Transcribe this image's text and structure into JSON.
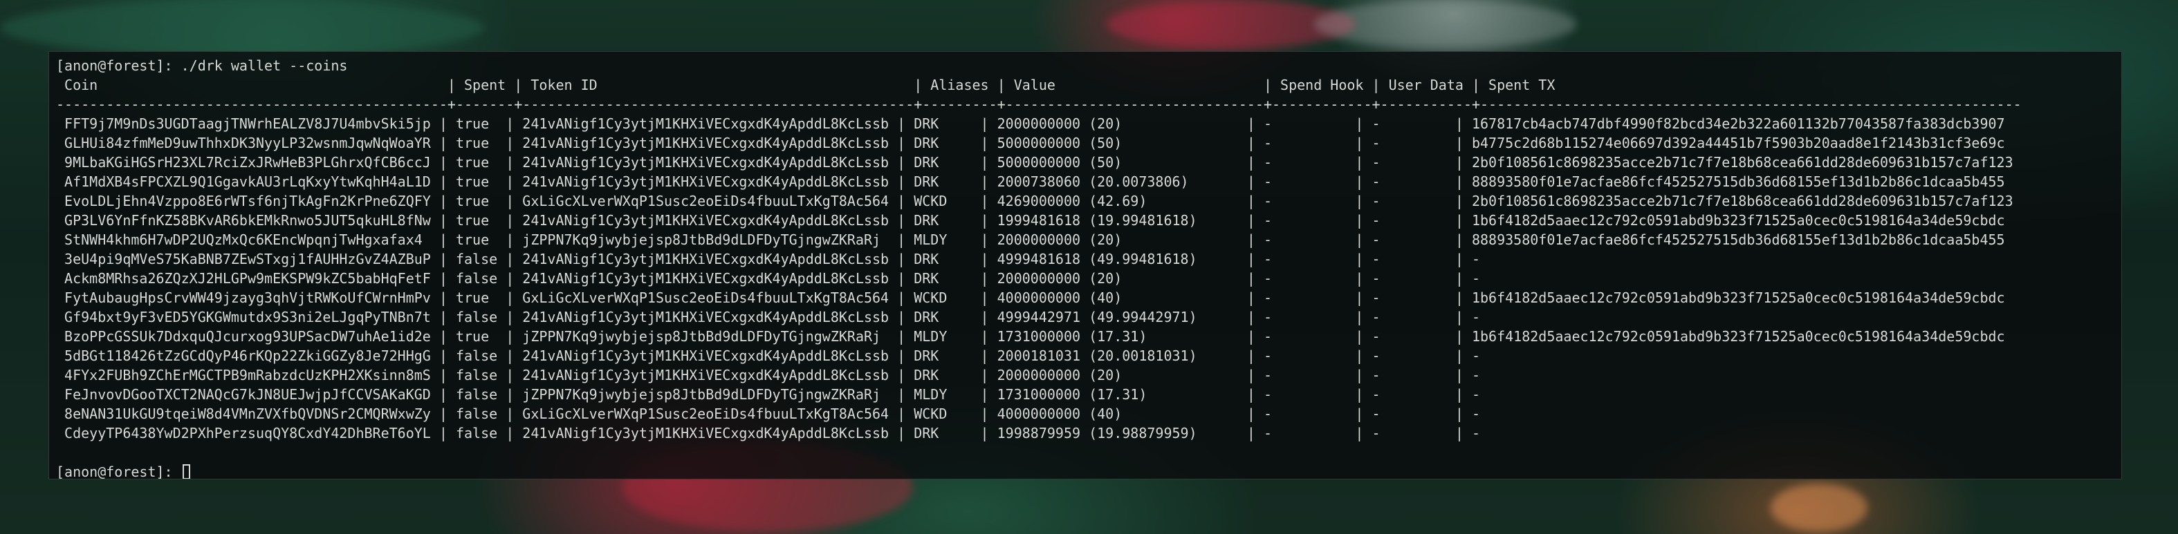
{
  "terminal": {
    "prompt": "[anon@forest]:",
    "command": "./drk wallet --coins",
    "header": " Coin                                          | Spent | Token ID                                      | Aliases | Value                         | Spend Hook | User Data | Spent TX",
    "separator": "-----------------------------------------------+-------+-----------------------------------------------+---------+-------------------------------+------------+-----------+-----------------------------------------------------------------",
    "columns": [
      "Coin",
      "Spent",
      "Token ID",
      "Aliases",
      "Value",
      "Spend Hook",
      "User Data",
      "Spent TX"
    ],
    "rows": [
      " FFT9j7M9nDs3UGDTaagjTNWrhEALZV8J7U4mbvSki5jp | true  | 241vANigf1Cy3ytjM1KHXiVECxgxdK4yApddL8KcLssb | DRK     | 2000000000 (20)               | -          | -         | 167817cb4acb747dbf4990f82bcd34e2b322a601132b77043587fa383dcb3907",
      " GLHUi84zfmMeD9uwThhxDK3NyyLP32wsnmJqwNqWoaYR | true  | 241vANigf1Cy3ytjM1KHXiVECxgxdK4yApddL8KcLssb | DRK     | 5000000000 (50)               | -          | -         | b4775c2d68b115274e06697d392a44451b7f5903b20aad8e1f2143b31cf3e69c",
      " 9MLbaKGiHGSrH23XL7RciZxJRwHeB3PLGhrxQfCB6ccJ | true  | 241vANigf1Cy3ytjM1KHXiVECxgxdK4yApddL8KcLssb | DRK     | 5000000000 (50)               | -          | -         | 2b0f108561c8698235acce2b71c7f7e18b68cea661dd28de609631b157c7af123",
      " Af1MdXB4sFPCXZL9Q1GgavkAU3rLqKxyYtwKqhH4aL1D | true  | 241vANigf1Cy3ytjM1KHXiVECxgxdK4yApddL8KcLssb | DRK     | 2000738060 (20.0073806)       | -          | -         | 88893580f01e7acfae86fcf452527515db36d68155ef13d1b2b86c1dcaa5b455",
      " EvoLDLjEhn4Vzppo8E6rWTsf6njTkAgFn2KrPne6ZQFY | true  | GxLiGcXLverWXqP1Susc2eoEiDs4fbuuLTxKgT8Ac564 | WCKD    | 4269000000 (42.69)            | -          | -         | 2b0f108561c8698235acce2b71c7f7e18b68cea661dd28de609631b157c7af123",
      " GP3LV6YnFfnKZ58BKvAR6bkEMkRnwo5JUT5qkuHL8fNw | true  | 241vANigf1Cy3ytjM1KHXiVECxgxdK4yApddL8KcLssb | DRK     | 1999481618 (19.99481618)      | -          | -         | 1b6f4182d5aaec12c792c0591abd9b323f71525a0cec0c5198164a34de59cbdc",
      " StNWH4khm6H7wDP2UQzMxQc6KEncWpqnjTwHgxafax4  | true  | jZPPN7Kq9jwybjejsp8JtbBd9dLDFDyTGjngwZKRaRj  | MLDY    | 2000000000 (20)               | -          | -         | 88893580f01e7acfae86fcf452527515db36d68155ef13d1b2b86c1dcaa5b455",
      " 3eU4pi9qMVeS75KaBNB7ZEwSTxgj1fAUHHzGvZ4AZBuP | false | 241vANigf1Cy3ytjM1KHXiVECxgxdK4yApddL8KcLssb | DRK     | 4999481618 (49.99481618)      | -          | -         | -",
      " Ackm8MRhsa26ZQzXJ2HLGPw9mEKSPW9kZC5babHqFetF | false | 241vANigf1Cy3ytjM1KHXiVECxgxdK4yApddL8KcLssb | DRK     | 2000000000 (20)               | -          | -         | -",
      " FytAubaugHpsCrvWW49jzayg3qhVjtRWKoUfCWrnHmPv | true  | GxLiGcXLverWXqP1Susc2eoEiDs4fbuuLTxKgT8Ac564 | WCKD    | 4000000000 (40)               | -          | -         | 1b6f4182d5aaec12c792c0591abd9b323f71525a0cec0c5198164a34de59cbdc",
      " Gf94bxt9yF3vED5YGKGWmutdx9S3ni2eLJgqPyTNBn7t | false | 241vANigf1Cy3ytjM1KHXiVECxgxdK4yApddL8KcLssb | DRK     | 4999442971 (49.99442971)      | -          | -         | -",
      " BzoPPcGSSUk7DdxquQJcurxog93UPSacDW7uhAe1id2e | true  | jZPPN7Kq9jwybjejsp8JtbBd9dLDFDyTGjngwZKRaRj  | MLDY    | 1731000000 (17.31)            | -          | -         | 1b6f4182d5aaec12c792c0591abd9b323f71525a0cec0c5198164a34de59cbdc",
      " 5dBGt118426tZzGCdQyP46rKQp22ZkiGGZy8Je72HHgG | false | 241vANigf1Cy3ytjM1KHXiVECxgxdK4yApddL8KcLssb | DRK     | 2000181031 (20.00181031)      | -          | -         | -",
      " 4FYx2FUBh9ZChErMGCTPB9mRabzdcUzKPH2XKsinn8mS | false | 241vANigf1Cy3ytjM1KHXiVECxgxdK4yApddL8KcLssb | DRK     | 2000000000 (20)               | -          | -         | -",
      " FeJnvovDGooTXCT2NAQcG7kJN8UEJwjpJfCCVSAKaKGD | false | jZPPN7Kq9jwybjejsp8JtbBd9dLDFDyTGjngwZKRaRj  | MLDY    | 1731000000 (17.31)            | -          | -         | -",
      " 8eNAN31UkGU9tqeiW8d4VMnZVXfbQVDNSr2CMQRWxwZy | false | GxLiGcXLverWXqP1Susc2eoEiDs4fbuuLTxKgT8Ac564 | WCKD    | 4000000000 (40)               | -          | -         | -",
      " CdeyyTP6438YwD2PXhPerzsuqQY8CxdY42DhBReT6oYL | false | 241vANigf1Cy3ytjM1KHXiVECxgxdK4yApddL8KcLssb | DRK     | 1998879959 (19.98879959)      | -          | -         | -"
    ],
    "final_prompt": "[anon@forest]:"
  }
}
